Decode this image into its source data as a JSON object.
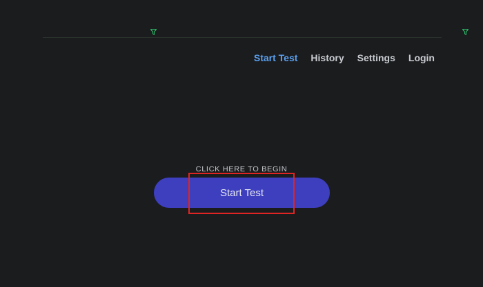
{
  "nav": {
    "items": [
      {
        "label": "Start Test",
        "active": true
      },
      {
        "label": "History",
        "active": false
      },
      {
        "label": "Settings",
        "active": false
      },
      {
        "label": "Login",
        "active": false
      }
    ]
  },
  "hero": {
    "prompt": "CLICK HERE TO BEGIN",
    "button_label": "Start Test"
  },
  "icons": {
    "filter": "filter-icon"
  },
  "colors": {
    "background": "#1b1c1e",
    "nav_active": "#5aa0f0",
    "nav_text": "#c8cbd0",
    "button": "#3d3fbf",
    "icon_accent": "#2ecc71",
    "highlight": "#e02424"
  }
}
